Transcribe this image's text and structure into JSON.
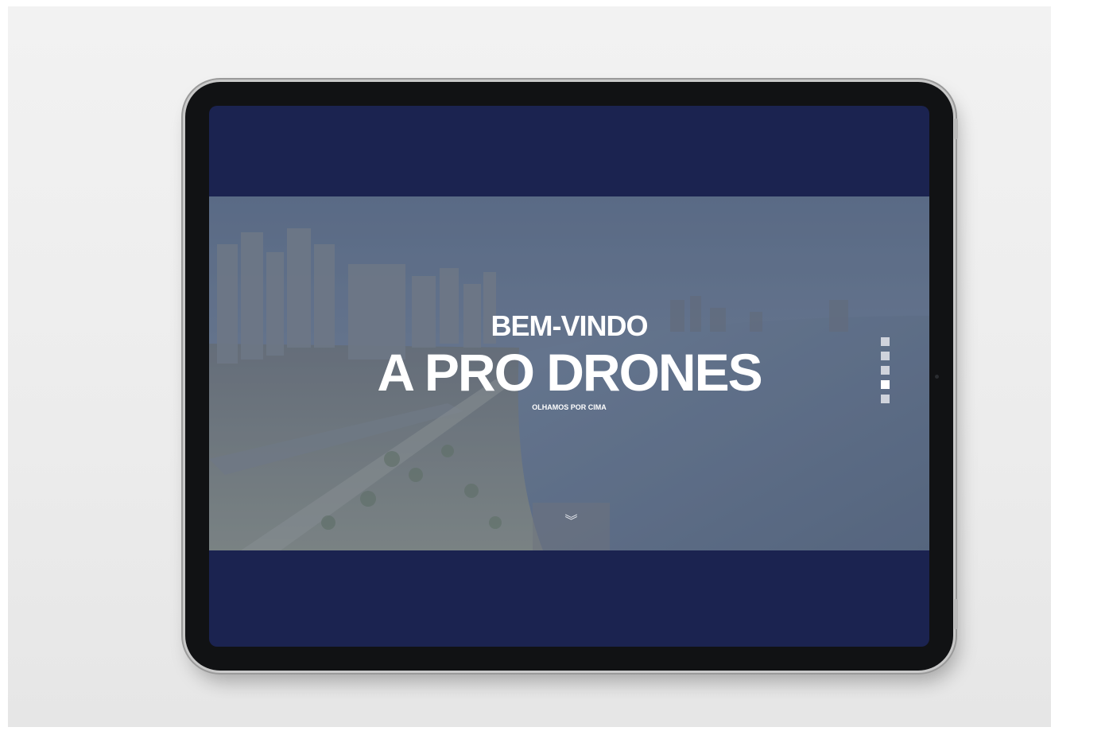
{
  "hero": {
    "headline_top": "BEM-VINDO",
    "headline_main": "A PRO DRONES",
    "tagline": "OLHAMOS POR CIMA"
  },
  "section_nav": {
    "count": 5,
    "active_index": 3
  },
  "scroll_down": {
    "icon": "double-chevron-down-icon",
    "glyph": "︾"
  },
  "colors": {
    "screen_background": "#1b2350",
    "headline_text": "#ffffff",
    "tablet_bezel": "#111214"
  }
}
